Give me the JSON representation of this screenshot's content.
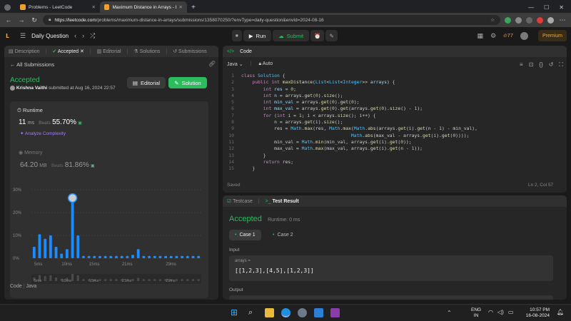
{
  "browser": {
    "tabs": [
      {
        "title": "Problems - LeetCode"
      },
      {
        "title": "Maximum Distance in Arrays - Le"
      }
    ],
    "url_host": "https://leetcode.com",
    "url_path": "/problems/maximum-distance-in-arrays/submissions/1358070250/?envType=daily-question&envId=2024-08-16"
  },
  "lc_nav": {
    "daily_question": "Daily Question",
    "run_label": "Run",
    "submit_label": "Submit",
    "streak": "77",
    "premium_label": "Premium"
  },
  "left_panel": {
    "tabs": [
      "Description",
      "Accepted",
      "Editorial",
      "Solutions",
      "Submissions"
    ],
    "all_submissions": "All Submissions",
    "status": "Accepted",
    "user": "Krishna Vaithi",
    "submitted_at": "submitted at Aug 16, 2024 22:57",
    "editorial_btn": "Editorial",
    "solution_btn": "Solution",
    "runtime": {
      "label": "Runtime",
      "value": "11",
      "unit": "ms",
      "beats_label": "Beats",
      "beats": "55.70%",
      "analyze": "Analyze Complexity"
    },
    "memory": {
      "label": "Memory",
      "value": "64.20",
      "unit": "MB",
      "beats_label": "Beats",
      "beats": "81.86%"
    },
    "code_footer": {
      "code": "Code",
      "lang": "Java"
    }
  },
  "chart_data": {
    "type": "bar",
    "x_ticks": [
      "5ms",
      "10ms",
      "15ms",
      "21ms",
      "29ms"
    ],
    "y_ticks": [
      "30%",
      "20%",
      "10%",
      "0%"
    ],
    "ylim": [
      0,
      30
    ],
    "values": [
      5,
      10.5,
      8.5,
      10,
      5,
      2,
      4,
      27,
      10,
      1,
      1,
      1,
      1,
      1,
      1,
      1,
      1,
      1,
      1.5,
      4,
      1,
      1,
      1,
      1,
      1,
      1,
      1,
      1,
      1,
      1,
      1
    ],
    "highlight_index": 7,
    "mini_ticks": [
      "5ms",
      "10ms",
      "15ms",
      "21ms",
      "29ms"
    ]
  },
  "code_panel": {
    "title": "Code",
    "lang": "Java",
    "mode": "Auto",
    "saved": "Saved",
    "cursor": "Ln 2, Col 57",
    "lines": [
      [
        [
          "kw",
          "class "
        ],
        [
          "ty",
          "Solution"
        ],
        [
          "pl",
          " {"
        ]
      ],
      [
        [
          "pl",
          "    "
        ],
        [
          "kw",
          "public int "
        ],
        [
          "fn",
          "maxDistance"
        ],
        [
          "pl",
          "("
        ],
        [
          "ty",
          "List"
        ],
        [
          "pl",
          "<"
        ],
        [
          "ty",
          "List"
        ],
        [
          "pl",
          "<"
        ],
        [
          "ty",
          "Integer"
        ],
        [
          "pl",
          ">> "
        ],
        [
          "vr",
          "arrays"
        ],
        [
          "pl",
          ") {"
        ]
      ],
      [
        [
          "pl",
          "        "
        ],
        [
          "kw",
          "int "
        ],
        [
          "vr",
          "res"
        ],
        [
          "pl",
          " = "
        ],
        [
          "nm",
          "0"
        ],
        [
          "pl",
          ";"
        ]
      ],
      [
        [
          "pl",
          "        "
        ],
        [
          "kw",
          "int "
        ],
        [
          "vr",
          "n"
        ],
        [
          "pl",
          " = arrays."
        ],
        [
          "fn",
          "get"
        ],
        [
          "pl",
          "("
        ],
        [
          "nm",
          "0"
        ],
        [
          "pl",
          ")."
        ],
        [
          "fn",
          "size"
        ],
        [
          "pl",
          "();"
        ]
      ],
      [
        [
          "pl",
          "        "
        ],
        [
          "kw",
          "int "
        ],
        [
          "vr",
          "min_val"
        ],
        [
          "pl",
          " = arrays."
        ],
        [
          "fn",
          "get"
        ],
        [
          "pl",
          "("
        ],
        [
          "nm",
          "0"
        ],
        [
          "pl",
          ")."
        ],
        [
          "fn",
          "get"
        ],
        [
          "pl",
          "("
        ],
        [
          "nm",
          "0"
        ],
        [
          "pl",
          ");"
        ]
      ],
      [
        [
          "pl",
          "        "
        ],
        [
          "kw",
          "int "
        ],
        [
          "vr",
          "max_val"
        ],
        [
          "pl",
          " = arrays."
        ],
        [
          "fn",
          "get"
        ],
        [
          "pl",
          "("
        ],
        [
          "nm",
          "0"
        ],
        [
          "pl",
          ")."
        ],
        [
          "fn",
          "get"
        ],
        [
          "pl",
          "(arrays."
        ],
        [
          "fn",
          "get"
        ],
        [
          "pl",
          "("
        ],
        [
          "nm",
          "0"
        ],
        [
          "pl",
          ")."
        ],
        [
          "fn",
          "size"
        ],
        [
          "pl",
          "() - "
        ],
        [
          "nm",
          "1"
        ],
        [
          "pl",
          ");"
        ]
      ],
      [
        [
          "pl",
          "        "
        ],
        [
          "kw",
          "for "
        ],
        [
          "pl",
          "("
        ],
        [
          "kw",
          "int "
        ],
        [
          "vr",
          "i"
        ],
        [
          "pl",
          " = "
        ],
        [
          "nm",
          "1"
        ],
        [
          "pl",
          "; i < arrays."
        ],
        [
          "fn",
          "size"
        ],
        [
          "pl",
          "(); i++) {"
        ]
      ],
      [
        [
          "pl",
          "            n = arrays."
        ],
        [
          "fn",
          "get"
        ],
        [
          "pl",
          "(i)."
        ],
        [
          "fn",
          "size"
        ],
        [
          "pl",
          "();"
        ]
      ],
      [
        [
          "pl",
          "            res = "
        ],
        [
          "ty",
          "Math"
        ],
        [
          "pl",
          "."
        ],
        [
          "fn",
          "max"
        ],
        [
          "pl",
          "(res, "
        ],
        [
          "ty",
          "Math"
        ],
        [
          "pl",
          "."
        ],
        [
          "fn",
          "max"
        ],
        [
          "pl",
          "("
        ],
        [
          "ty",
          "Math"
        ],
        [
          "pl",
          "."
        ],
        [
          "fn",
          "abs"
        ],
        [
          "pl",
          "(arrays."
        ],
        [
          "fn",
          "get"
        ],
        [
          "pl",
          "(i)."
        ],
        [
          "fn",
          "get"
        ],
        [
          "pl",
          "(n - "
        ],
        [
          "nm",
          "1"
        ],
        [
          "pl",
          ") - min_val),"
        ]
      ],
      [
        [
          "pl",
          "                                        "
        ],
        [
          "ty",
          "Math"
        ],
        [
          "pl",
          "."
        ],
        [
          "fn",
          "abs"
        ],
        [
          "pl",
          "(max_val - arrays."
        ],
        [
          "fn",
          "get"
        ],
        [
          "pl",
          "(i)."
        ],
        [
          "fn",
          "get"
        ],
        [
          "pl",
          "("
        ],
        [
          "nm",
          "0"
        ],
        [
          "pl",
          "))));"
        ]
      ],
      [
        [
          "pl",
          "            min_val = "
        ],
        [
          "ty",
          "Math"
        ],
        [
          "pl",
          "."
        ],
        [
          "fn",
          "min"
        ],
        [
          "pl",
          "(min_val, arrays."
        ],
        [
          "fn",
          "get"
        ],
        [
          "pl",
          "(i)."
        ],
        [
          "fn",
          "get"
        ],
        [
          "pl",
          "("
        ],
        [
          "nm",
          "0"
        ],
        [
          "pl",
          "));"
        ]
      ],
      [
        [
          "pl",
          "            max_val = "
        ],
        [
          "ty",
          "Math"
        ],
        [
          "pl",
          "."
        ],
        [
          "fn",
          "max"
        ],
        [
          "pl",
          "(max_val, arrays."
        ],
        [
          "fn",
          "get"
        ],
        [
          "pl",
          "(i)."
        ],
        [
          "fn",
          "get"
        ],
        [
          "pl",
          "(n - "
        ],
        [
          "nm",
          "1"
        ],
        [
          "pl",
          "));"
        ]
      ],
      [
        [
          "pl",
          "        }"
        ]
      ],
      [
        [
          "pl",
          "        "
        ],
        [
          "kw",
          "return "
        ],
        [
          "pl",
          "res;"
        ]
      ],
      [
        [
          "pl",
          "    }"
        ]
      ]
    ]
  },
  "result_panel": {
    "tabs": [
      "Testcase",
      "Test Result"
    ],
    "status": "Accepted",
    "runtime": "Runtime: 0 ms",
    "cases": [
      "Case 1",
      "Case 2"
    ],
    "input_label": "Input",
    "input_var": "arrays =",
    "input_value": "[[1,2,3],[4,5],[1,2,3]]",
    "output_label": "Output"
  },
  "taskbar": {
    "lang": "ENG",
    "region": "IN",
    "time": "10:57 PM",
    "date": "16-08-2024"
  }
}
